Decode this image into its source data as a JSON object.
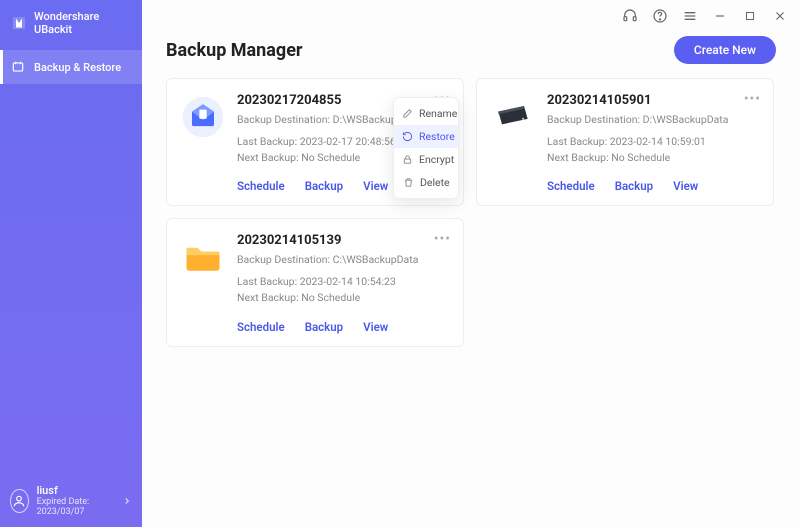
{
  "brand": {
    "name": "Wondershare UBackit"
  },
  "sidebar": {
    "items": [
      {
        "label": "Backup & Restore"
      }
    ]
  },
  "user": {
    "name": "liusf",
    "expired_label": "Expired Date: 2023/03/07"
  },
  "header": {
    "title": "Backup Manager",
    "create_label": "Create New"
  },
  "cards": [
    {
      "title": "20230217204855",
      "dest": "Backup Destination: D:\\WSBackupData",
      "last": "Last Backup: 2023-02-17 20:48:56",
      "next": "Next Backup: No Schedule",
      "actions": {
        "schedule": "Schedule",
        "backup": "Backup",
        "view": "View"
      },
      "icon": "mail"
    },
    {
      "title": "20230214105901",
      "dest": "Backup Destination: D:\\WSBackupData",
      "last": "Last Backup: 2023-02-14 10:59:01",
      "next": "Next Backup: No Schedule",
      "actions": {
        "schedule": "Schedule",
        "backup": "Backup",
        "view": "View"
      },
      "icon": "disk"
    },
    {
      "title": "20230214105139",
      "dest": "Backup Destination: C:\\WSBackupData",
      "last": "Last Backup: 2023-02-14 10:54:23",
      "next": "Next Backup: No Schedule",
      "actions": {
        "schedule": "Schedule",
        "backup": "Backup",
        "view": "View"
      },
      "icon": "folder"
    }
  ],
  "context_menu": {
    "rename": "Rename",
    "restore": "Restore",
    "encrypt": "Encrypt",
    "delete": "Delete"
  }
}
